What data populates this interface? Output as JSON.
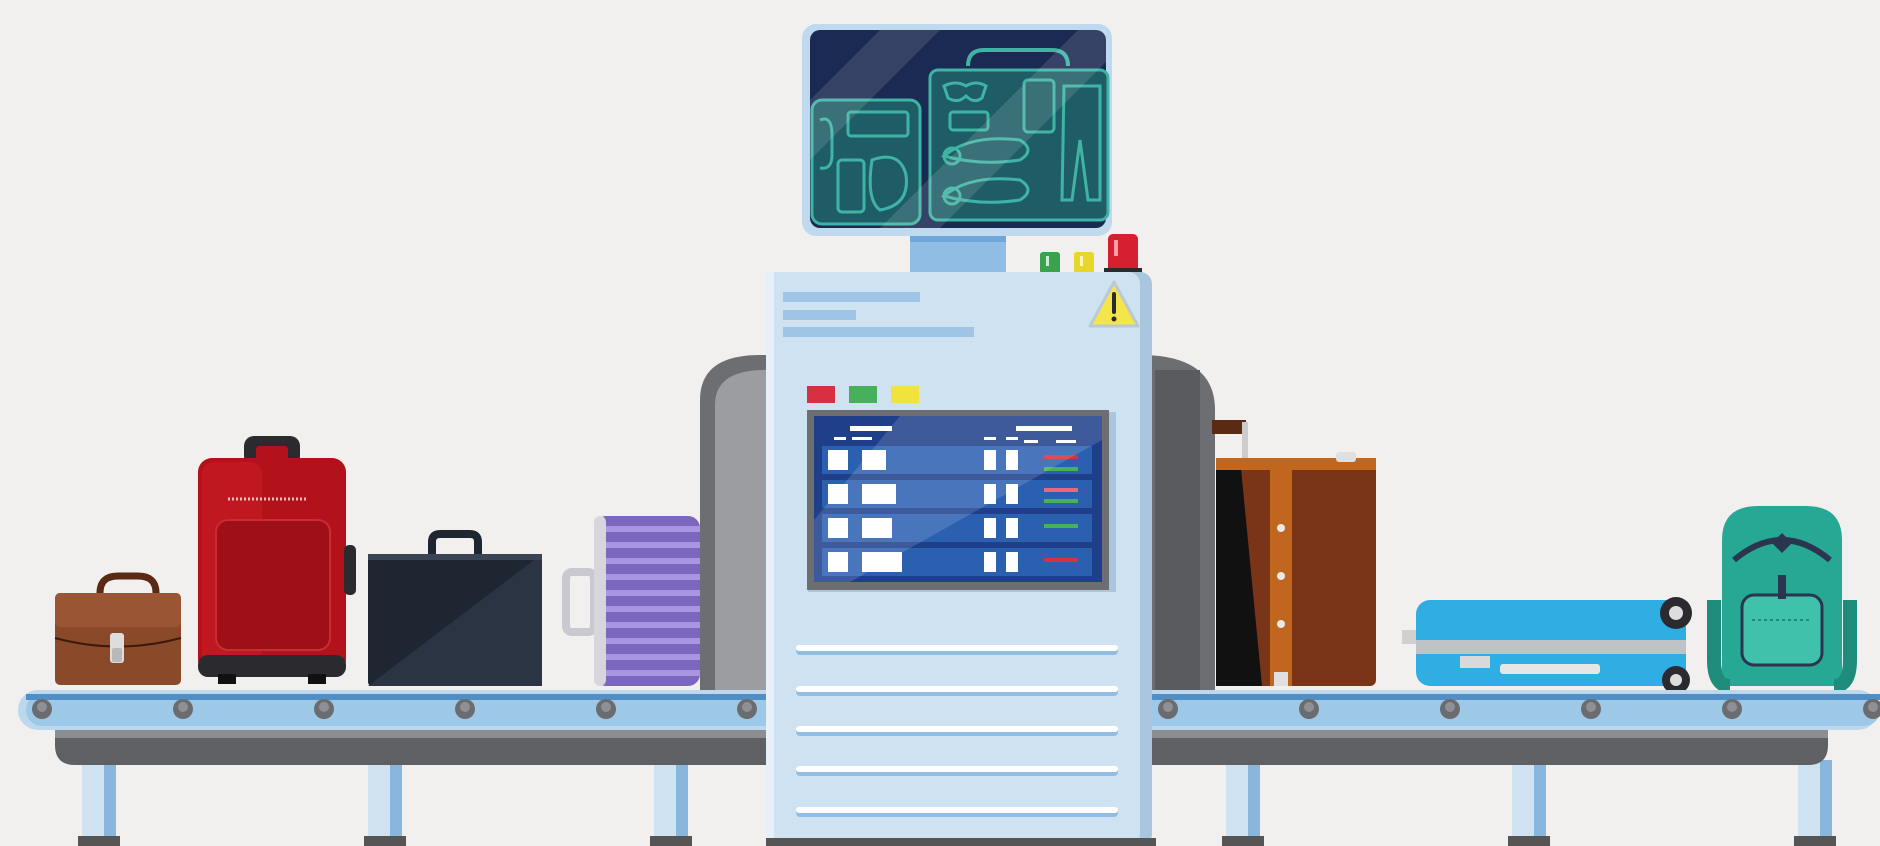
{
  "scene": {
    "description_free": true,
    "palette": {
      "background": "#f1f0ef",
      "belt": "#9ec8e8",
      "belt_dark": "#4f8fc6",
      "machine": "#cfe2f1",
      "machine_shadow": "#a9c6de",
      "tunnel": "#6d6e72",
      "monitor_frame": "#bfd9ee",
      "monitor_screen": "#1b2a52",
      "xray": "#3fb3a4",
      "board": "#1f3f8a",
      "board_row": "#2b5fb0",
      "red": "#d63041",
      "green": "#47b05a",
      "yellow": "#f1e23c",
      "warning": "#f4e64a"
    },
    "items": [
      {
        "name": "briefcase-brown-icon",
        "color": "#8a4a2a"
      },
      {
        "name": "suitcase-red-icon",
        "color": "#b3121b"
      },
      {
        "name": "briefcase-black-icon",
        "color": "#1e2632"
      },
      {
        "name": "suitcase-purple-icon",
        "color": "#8a72c8"
      },
      {
        "name": "trunk-brown-icon",
        "color": "#7a3418"
      },
      {
        "name": "suitcase-blue-icon",
        "color": "#2eaee2"
      },
      {
        "name": "backpack-green-icon",
        "color": "#27a894"
      }
    ],
    "status_lights": [
      "green",
      "yellow",
      "red"
    ],
    "warning_symbol": "!"
  }
}
